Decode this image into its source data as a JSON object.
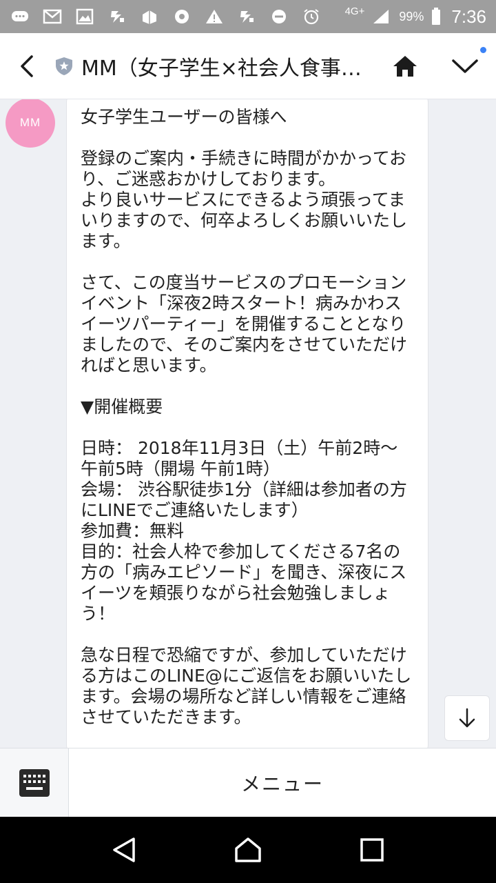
{
  "status_bar": {
    "network": "4G+",
    "battery": "99%",
    "time": "7:36",
    "icons": [
      "chat-bubble-icon",
      "mail-icon",
      "image-icon",
      "game-char-icon",
      "package-icon",
      "chrome-icon",
      "warning-icon",
      "game-char-icon",
      "do-not-disturb-icon",
      "alarm-icon"
    ]
  },
  "header": {
    "title": "MM（女子学生×社会人食事…",
    "badge_icon": "shield-star-icon",
    "accent": "#3b82f6"
  },
  "avatar": {
    "text": "MM",
    "color": "#f59ac4"
  },
  "message": {
    "text": "女子学生ユーザーの皆様へ\n\n登録のご案内・手続きに時間がかかっており、ご迷惑おかけしております。\nより良いサービスにできるよう頑張ってまいりますので、何卒よろしくお願いいたします。\n\nさて、この度当サービスのプロモーションイベント「深夜2時スタート！病みかわスイーツパーティー」を開催することとなりましたので、そのご案内をさせていただければと思います。\n\n▼開催概要\n\n日時： 2018年11月3日（土）午前2時〜午前5時（開場 午前1時）\n会場： 渋谷駅徒歩1分（詳細は参加者の方にLINEでご連絡いたします）\n参加費：無料\n目的：社会人枠で参加してくださる7名の方の「病みエピソード」を聞き、深夜にスイーツを頬張りながら社会勉強しましょう！\n\n急な日程で恐縮ですが、参加していただける方はこのLINE@にご返信をお願いいたします。会場の場所など詳しい情報をご連絡させていただきます。"
  },
  "bottom_bar": {
    "menu_label": "メニュー"
  }
}
